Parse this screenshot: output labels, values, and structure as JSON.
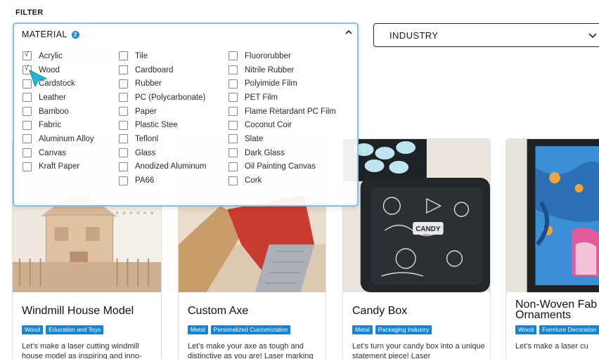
{
  "filter_title": "FILTER",
  "background_chips": [
    "",
    ""
  ],
  "industry": {
    "label": "INDUSTRY"
  },
  "material": {
    "label": "MATERIAL",
    "badge": "2",
    "columns": [
      [
        {
          "label": "Acrylic",
          "checked": true
        },
        {
          "label": "Wood",
          "checked": true
        },
        {
          "label": "Cardstock",
          "checked": false
        },
        {
          "label": "Leather",
          "checked": false
        },
        {
          "label": "Bamboo",
          "checked": false
        },
        {
          "label": "Fabric",
          "checked": false
        },
        {
          "label": "Aluminum Alloy",
          "checked": false
        },
        {
          "label": "Canvas",
          "checked": false
        },
        {
          "label": "Kraft Paper",
          "checked": false
        }
      ],
      [
        {
          "label": "Tile",
          "checked": false
        },
        {
          "label": "Cardboard",
          "checked": false
        },
        {
          "label": "Rubber",
          "checked": false
        },
        {
          "label": "PC (Polycarbonate)",
          "checked": false
        },
        {
          "label": "Paper",
          "checked": false
        },
        {
          "label": "Plastic Stee",
          "checked": false
        },
        {
          "label": "Teflonl",
          "checked": false
        },
        {
          "label": "Glass",
          "checked": false
        },
        {
          "label": "Anodized Aluminum",
          "checked": false
        },
        {
          "label": "PA66",
          "checked": false
        }
      ],
      [
        {
          "label": "Fluororubber",
          "checked": false
        },
        {
          "label": "Nitrile Rubber",
          "checked": false
        },
        {
          "label": "Polyimide Film",
          "checked": false
        },
        {
          "label": "PET Film",
          "checked": false
        },
        {
          "label": "Flame Retardant PC Film",
          "checked": false
        },
        {
          "label": "Coconut Coir",
          "checked": false
        },
        {
          "label": "Slate",
          "checked": false
        },
        {
          "label": "Dark Glass",
          "checked": false
        },
        {
          "label": "Oil Painting Canvas",
          "checked": false
        },
        {
          "label": "Cork",
          "checked": false
        }
      ]
    ]
  },
  "cards": [
    {
      "title": "Windmill House Model",
      "tags": [
        "Wood",
        "Education and Toys"
      ],
      "desc": "Let’s make a laser cutting windmill house model as inspiring and inno-"
    },
    {
      "title": "Custom Axe",
      "tags": [
        "Metal",
        "Personalized Customization"
      ],
      "desc": "Let’s make your axe as tough and distinctive as you are! Laser marking"
    },
    {
      "title": "Candy Box",
      "tags": [
        "Metal",
        "Packaging Industry"
      ],
      "desc": "Let’s turn your candy box into a unique statement piece! Laser"
    },
    {
      "title": "Non-Woven Fab Ornaments",
      "tags": [
        "Wood",
        "Furniture Decoration"
      ],
      "desc": "Let’s make a laser cu"
    }
  ],
  "colors": {
    "accent": "#1784d6",
    "panel_border": "#7fc0ec",
    "cursor": "#1fb8d8"
  }
}
